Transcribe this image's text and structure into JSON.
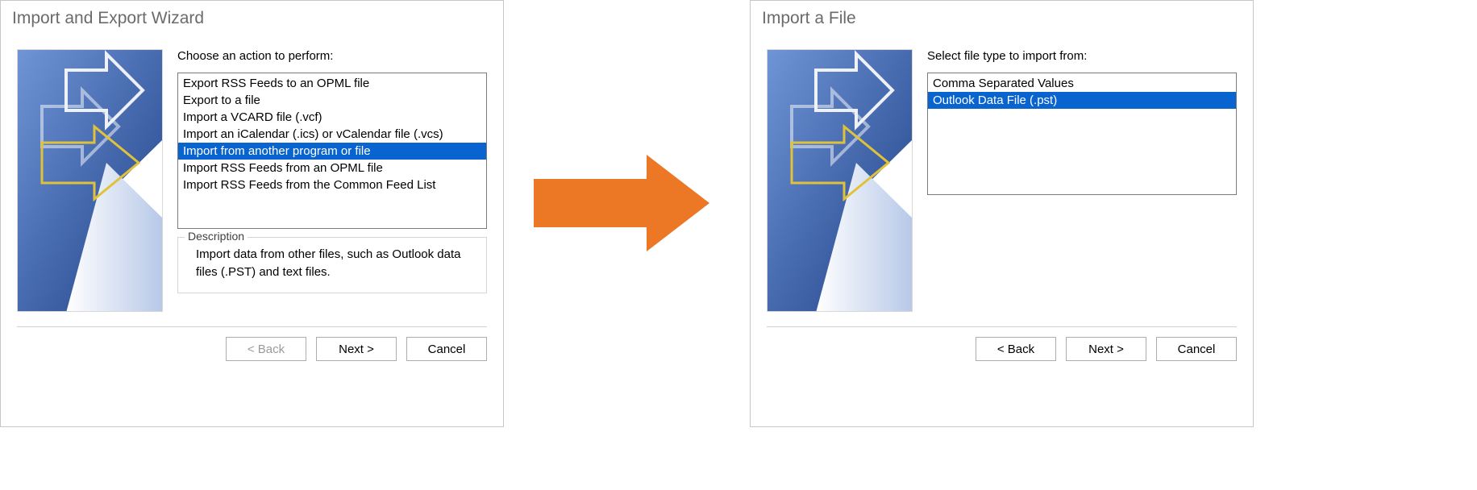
{
  "wiz1": {
    "title": "Import and Export Wizard",
    "prompt": "Choose an action to perform:",
    "actions": [
      "Export RSS Feeds to an OPML file",
      "Export to a file",
      "Import a VCARD file (.vcf)",
      "Import an iCalendar (.ics) or vCalendar file (.vcs)",
      "Import from another program or file",
      "Import RSS Feeds from an OPML file",
      "Import RSS Feeds from the Common Feed List"
    ],
    "selected_index": 4,
    "desc_label": "Description",
    "desc_text": "Import data from other files, such as Outlook data files (.PST) and text files.",
    "buttons": {
      "back": "< Back",
      "next": "Next >",
      "cancel": "Cancel"
    }
  },
  "wiz2": {
    "title": "Import a File",
    "prompt": "Select file type to import from:",
    "types": [
      "Comma Separated Values",
      "Outlook Data File (.pst)"
    ],
    "selected_index": 1,
    "buttons": {
      "back": "< Back",
      "next": "Next >",
      "cancel": "Cancel"
    }
  }
}
